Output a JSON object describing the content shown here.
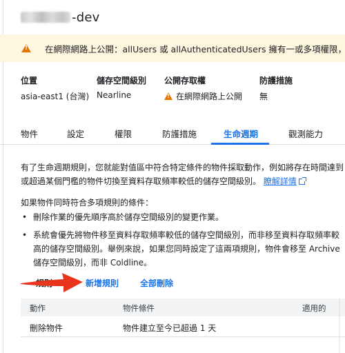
{
  "bucket": {
    "name_suffix": "-dev"
  },
  "banner": {
    "icon": "warning-icon",
    "text": "在網際網路上公開：allUsers 或 allAuthenticatedUsers 擁有一或多項權限，因此這"
  },
  "info": {
    "location_label": "位置",
    "location_value": "asia-east1 (台灣)",
    "storage_class_label": "儲存空間級別",
    "storage_class_value": "Nearline",
    "public_access_label": "公開存取權",
    "public_access_value": "在網際網路上公開",
    "protection_label": "防護措施",
    "protection_value": "無"
  },
  "tabs": [
    "物件",
    "設定",
    "權限",
    "防護措施",
    "生命週期",
    "觀測能力"
  ],
  "lifecycle": {
    "intro": "有了生命週期規則，您就能對值區中符合特定條件的物件採取動作，例如將存在時間達到或超過某個門檻的物件切換至資料存取頻率較低的儲存空間級別。",
    "learn_more": "瞭解詳情",
    "multi_rule_heading": "如果物件同時符合多項規則的條件：",
    "bullet1": "刪除作業的優先順序高於儲存空間級別的變更作業。",
    "bullet2": "系統會優先將物件移至資料存取頻率較低的儲存空間級別，而非移至資料存取頻率較高的儲存空間級別。舉例來說，如果您同時設定了這兩項規則，物件會移至 Archive 儲存空間級別，而非 Coldline。",
    "rules_label": "規則",
    "add_rule": "新增規則",
    "delete_all": "全部刪除"
  },
  "table": {
    "headers": [
      "動作",
      "物件條件",
      "適用的"
    ],
    "rows": [
      {
        "action": "刪除物件",
        "condition": "物件建立至今已超過 1 天"
      }
    ]
  },
  "colors": {
    "accent": "#1a73e8",
    "warning": "#e37400",
    "arrow": "#e8341c",
    "banner_bg": "#fef7e0"
  }
}
